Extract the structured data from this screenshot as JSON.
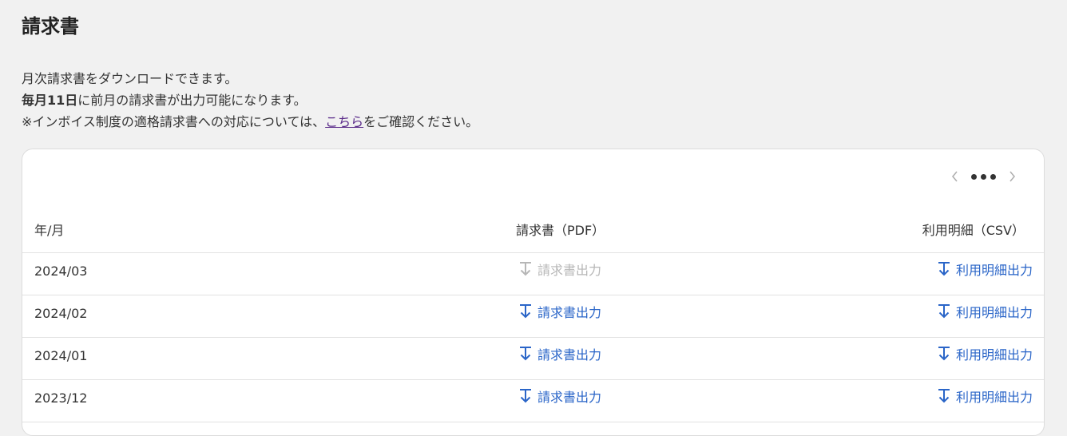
{
  "page": {
    "title": "請求書"
  },
  "description": {
    "line1": "月次請求書をダウンロードできます。",
    "line2_bold": "毎月11日",
    "line2_rest": "に前月の請求書が出力可能になります。",
    "line3_prefix": "※インボイス制度の適格請求書への対応については、",
    "line3_link": "こちら",
    "line3_suffix": "をご確認ください。"
  },
  "pager": {
    "prev_icon": "chevron-left-icon",
    "more_icon": "more-dots-icon",
    "next_icon": "chevron-right-icon"
  },
  "table": {
    "headers": {
      "year_month": "年/月",
      "invoice_pdf": "請求書（PDF）",
      "usage_csv": "利用明細（CSV）"
    },
    "rows": [
      {
        "year_month": "2024/03",
        "pdf_label": "請求書出力",
        "pdf_enabled": false,
        "csv_label": "利用明細出力",
        "csv_enabled": true
      },
      {
        "year_month": "2024/02",
        "pdf_label": "請求書出力",
        "pdf_enabled": true,
        "csv_label": "利用明細出力",
        "csv_enabled": true
      },
      {
        "year_month": "2024/01",
        "pdf_label": "請求書出力",
        "pdf_enabled": true,
        "csv_label": "利用明細出力",
        "csv_enabled": true
      },
      {
        "year_month": "2023/12",
        "pdf_label": "請求書出力",
        "pdf_enabled": true,
        "csv_label": "利用明細出力",
        "csv_enabled": true
      }
    ],
    "icon": "download-icon"
  },
  "colors": {
    "background": "#f1f1f1",
    "card": "#ffffff",
    "link_blue": "#2a65c8",
    "disabled_gray": "#b7b7b7",
    "visited_link_purple": "#5b2c8a",
    "text": "#333333"
  }
}
